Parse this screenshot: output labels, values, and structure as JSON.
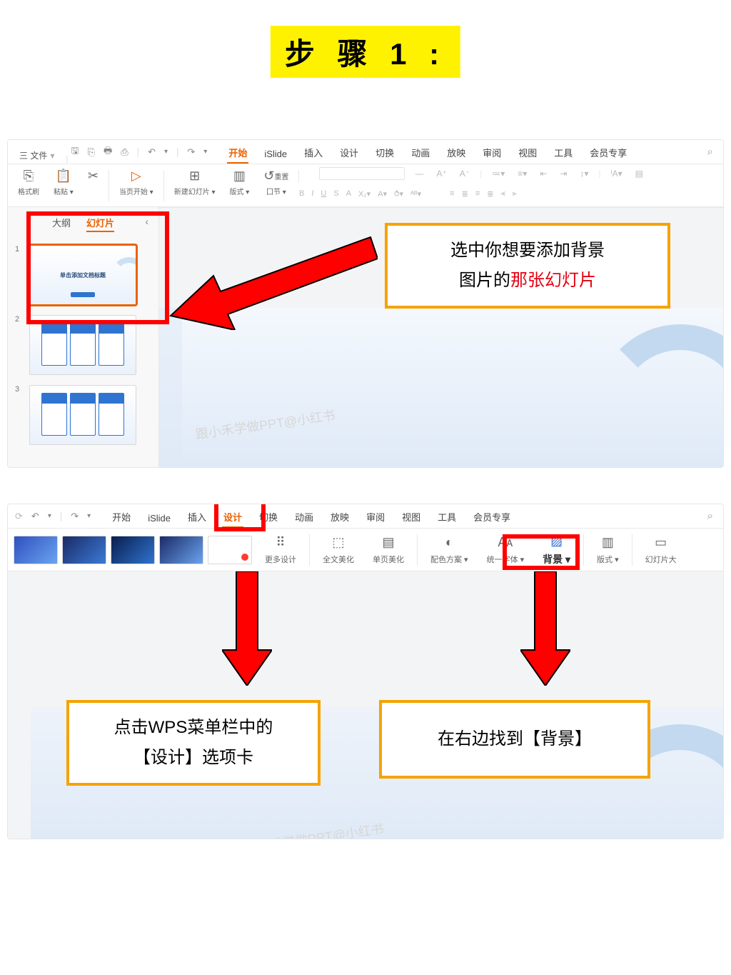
{
  "step_title": "步 骤 1 :",
  "watermark": "跟小禾学做PPT@小红书",
  "panel1": {
    "menubar": {
      "file": "三 文件",
      "qat_icons": [
        "save-icon",
        "open-icon",
        "print-icon",
        "redo-icon",
        "undo-chevron-icon",
        "undo-icon",
        "redo-chevron-icon"
      ],
      "tabs": [
        "开始",
        "iSlide",
        "插入",
        "设计",
        "切换",
        "动画",
        "放映",
        "审阅",
        "视图",
        "工具",
        "会员专享"
      ],
      "active_tab": "开始"
    },
    "ribbon": {
      "buttons": [
        {
          "label": "格式刷",
          "icon": "⎘"
        },
        {
          "label": "粘贴 ▾",
          "icon": "📋"
        },
        {
          "label": "",
          "icon": "✂"
        },
        {
          "label": "当页开始 ▾",
          "icon": "▷"
        },
        {
          "label": "新建幻灯片 ▾",
          "icon": "⊞"
        },
        {
          "label": "版式 ▾",
          "icon": "▥"
        },
        {
          "label": "重置",
          "icon": "↺"
        },
        {
          "label": "囗节 ▾",
          "icon": "囗"
        }
      ],
      "format_chips": [
        "B",
        "I",
        "U",
        "S",
        "A",
        "Aᵢ",
        "A▾",
        "≡▾",
        "≡",
        "≣",
        "≡",
        "⫶",
        "⇥",
        "⫷",
        "A↕",
        "↧"
      ]
    },
    "side": {
      "tabs": [
        "大纲",
        "幻灯片"
      ],
      "active": "幻灯片",
      "slide1_title": "单击添加文档标题",
      "slide_numbers": [
        "1",
        "2",
        "3"
      ]
    },
    "callout": {
      "line1": "选中你想要添加背景",
      "line2_a": "图片的",
      "line2_b": "那张幻灯片"
    }
  },
  "panel2": {
    "menubar": {
      "tabs": [
        "开始",
        "iSlide",
        "插入",
        "设计",
        "切换",
        "动画",
        "放映",
        "审阅",
        "视图",
        "工具",
        "会员专享"
      ],
      "active_tab": "设计"
    },
    "ribbon": {
      "buttons": [
        {
          "label": "更多设计",
          "icon": "⠿"
        },
        {
          "label": "全文美化",
          "icon": "⬚"
        },
        {
          "label": "单页美化",
          "icon": "▤"
        },
        {
          "label": "配色方案 ▾",
          "icon": "◐"
        },
        {
          "label": "统一字体 ▾",
          "icon": "Aᴀ"
        },
        {
          "label": "背景 ▾",
          "icon": "▨"
        },
        {
          "label": "版式 ▾",
          "icon": "▥"
        },
        {
          "label": "幻灯片大",
          "icon": "▭"
        }
      ]
    },
    "callout_left": {
      "line1": "点击WPS菜单栏中的",
      "line2": "【设计】选项卡"
    },
    "callout_right": {
      "line1": "在右边找到【背景】"
    }
  }
}
